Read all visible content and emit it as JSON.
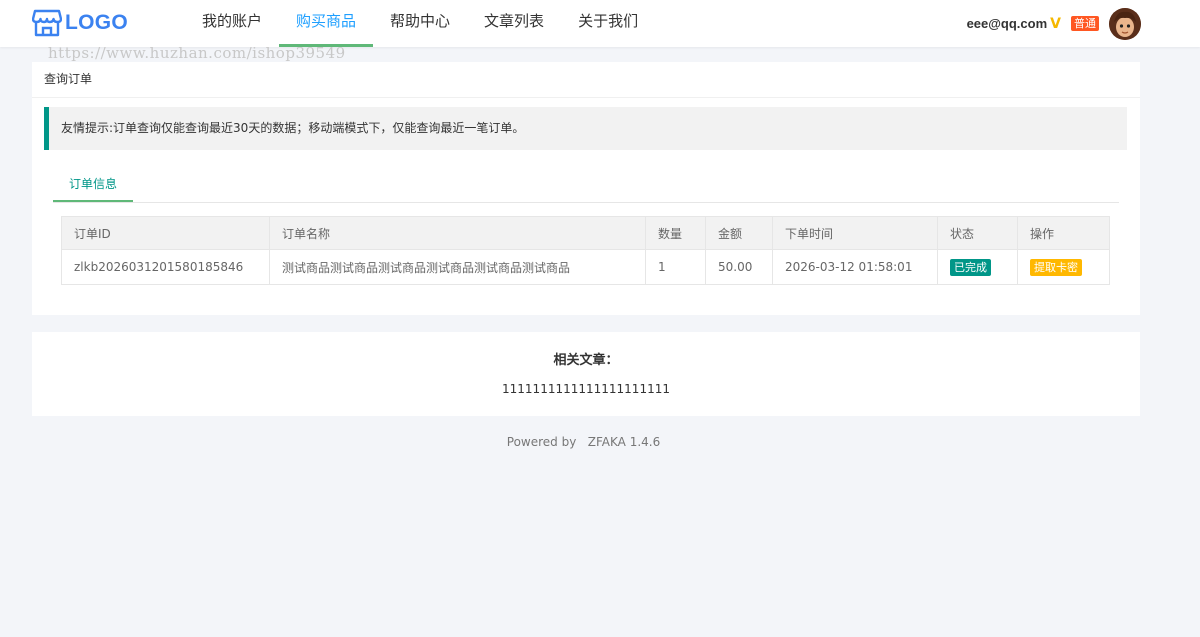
{
  "header": {
    "logo_text": "LOGO",
    "nav": [
      {
        "label": "我的账户",
        "active": false
      },
      {
        "label": "购买商品",
        "active": true
      },
      {
        "label": "帮助中心",
        "active": false
      },
      {
        "label": "文章列表",
        "active": false
      },
      {
        "label": "关于我们",
        "active": false
      }
    ],
    "user_email": "eee@qq.com",
    "vip_mark": "V",
    "level": "普通"
  },
  "watermark": "https://www.huzhan.com/ishop39549",
  "query_card": {
    "title": "查询订单",
    "tip": "友情提示:订单查询仅能查询最近30天的数据；移动端模式下，仅能查询最近一笔订单。",
    "tab": "订单信息",
    "columns": [
      "订单ID",
      "订单名称",
      "数量",
      "金额",
      "下单时间",
      "状态",
      "操作"
    ],
    "rows": [
      {
        "order_id": "zlkb2026031201580185846",
        "name": "测试商品测试商品测试商品测试商品测试商品测试商品",
        "quantity": "1",
        "amount": "50.00",
        "time": "2026-03-12 01:58:01",
        "status": "已完成",
        "action": "提取卡密"
      }
    ]
  },
  "related": {
    "title": "相关文章：",
    "item": "1111111111111111111111"
  },
  "footer": {
    "powered_by": "Powered by",
    "product": "ZFAKA 1.4.6"
  },
  "colors": {
    "accent_blue": "#1e9fff",
    "nav_underline": "#5fb878",
    "teal": "#009688",
    "badge_orange": "#ff5722",
    "badge_yellow": "#ffb800"
  }
}
